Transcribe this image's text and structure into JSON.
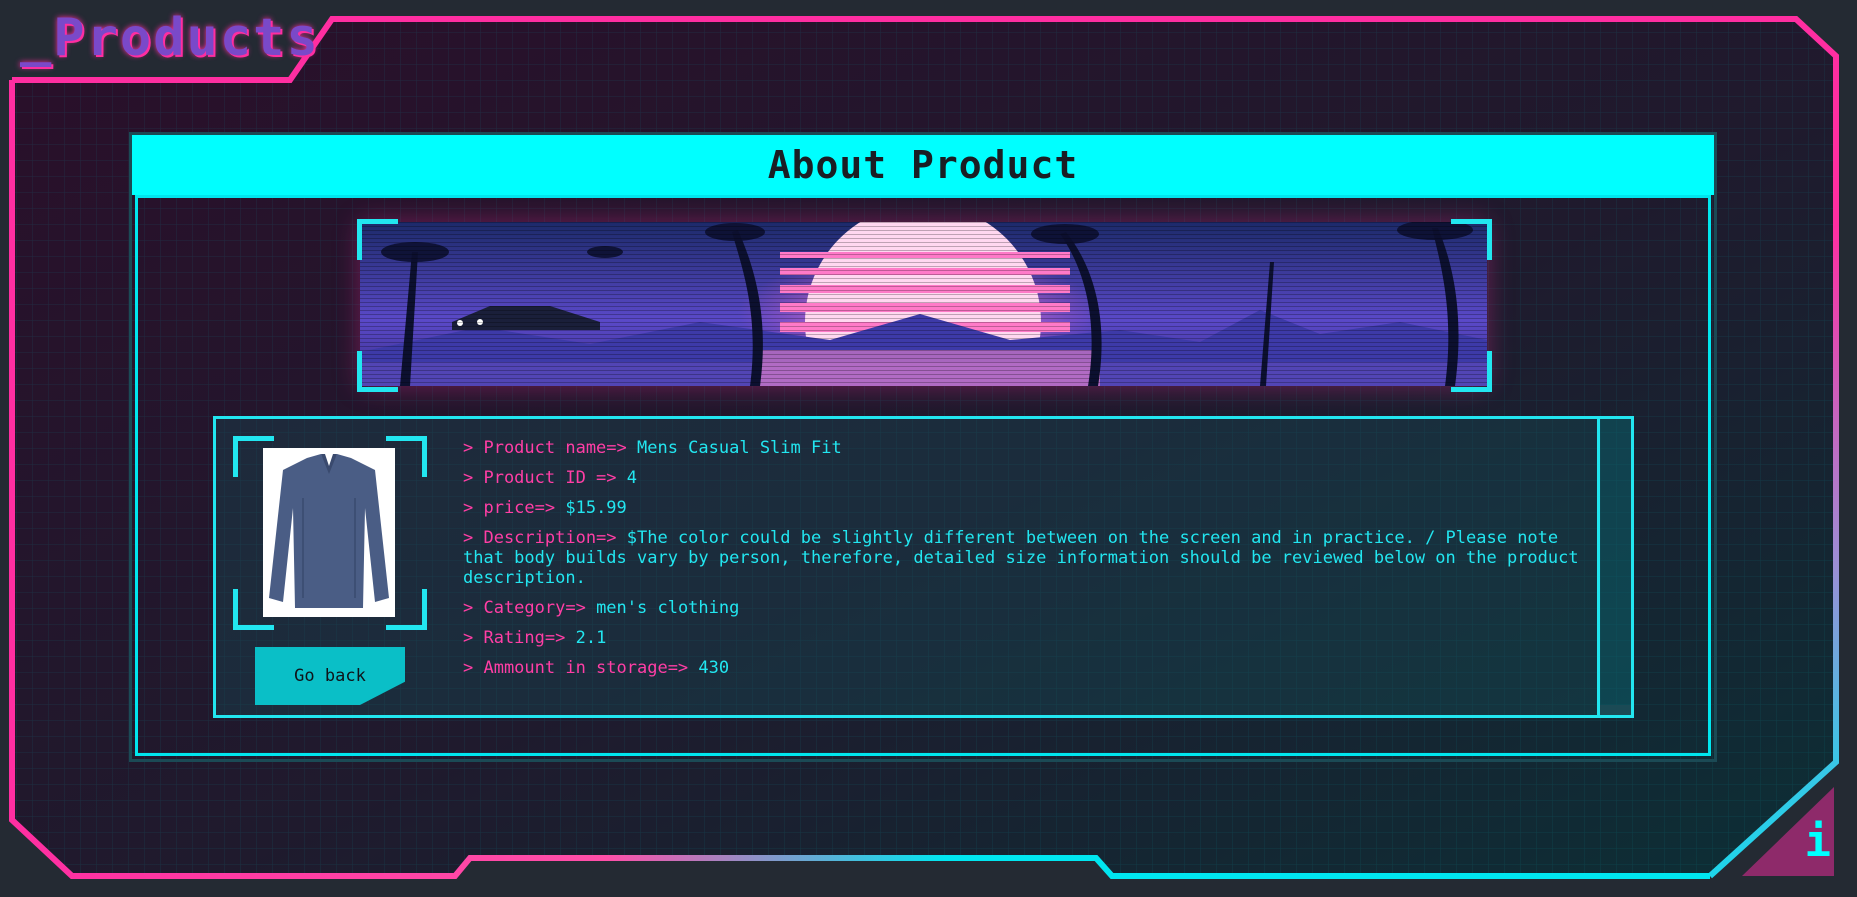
{
  "page": {
    "title": "_Products"
  },
  "panel": {
    "title": "About Product"
  },
  "product": {
    "name_label": "> Product name=> ",
    "name": "Mens Casual Slim Fit",
    "id_label": "> Product ID => ",
    "id": "4",
    "price_label": "> price=> ",
    "price": "$15.99",
    "description_label": "> Description=> ",
    "description": "$The color could be slightly different between on the screen and in practice. / Please note that body builds vary by person, therefore, detailed size information should be reviewed below on the product description.",
    "category_label": "> Category=> ",
    "category": "men's clothing",
    "rating_label": "> Rating=> ",
    "rating": "2.1",
    "storage_label": "> Ammount in storage=> ",
    "storage": "430"
  },
  "actions": {
    "go_back_label": "Go back"
  },
  "badge": {
    "info": "i"
  },
  "colors": {
    "background": "#242a33",
    "neon_pink": "#ff2ea1",
    "neon_cyan": "#00ffff",
    "button": "#0abfc7",
    "title_purple": "#7a49c9"
  },
  "icons": {
    "info_icon": "info-icon",
    "product_image": "long-sleeve-shirt-image",
    "banner": "synthwave-sunset-banner"
  }
}
